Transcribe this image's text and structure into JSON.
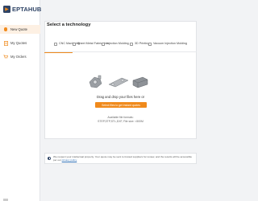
{
  "brand": {
    "name": "EPTAHUB"
  },
  "sidebar": {
    "items": [
      {
        "label": "New Quote",
        "icon": "new-quote-icon",
        "active": true
      },
      {
        "label": "My Quotes",
        "icon": "quotes-icon"
      },
      {
        "label": "My Orders",
        "icon": "orders-icon"
      }
    ]
  },
  "main": {
    "title": "Select a technology",
    "tabs": [
      {
        "label": "CNC Machining",
        "active": true
      },
      {
        "label": "Sheet Metal Fabrication"
      },
      {
        "label": "Injection Molding"
      },
      {
        "label": "3D Printing"
      },
      {
        "label": "Vacuum Injection Molding"
      }
    ],
    "dropzone": {
      "title": "Drag and drop your files here or",
      "button_label": "Select files to get instant quotes",
      "formats_title": "Available file formats:",
      "formats_list": "STEP,STP,STL,DXF, File size: <500M"
    }
  },
  "banner": {
    "text": "We respect your intellectual property. Your quote may be sent to trusted suppliers for review, and the results will be accessible per our ",
    "link": "privacy policy"
  },
  "colors": {
    "accent": "#f08a1c",
    "brand": "#2f4466",
    "background": "#f2f3f5"
  }
}
